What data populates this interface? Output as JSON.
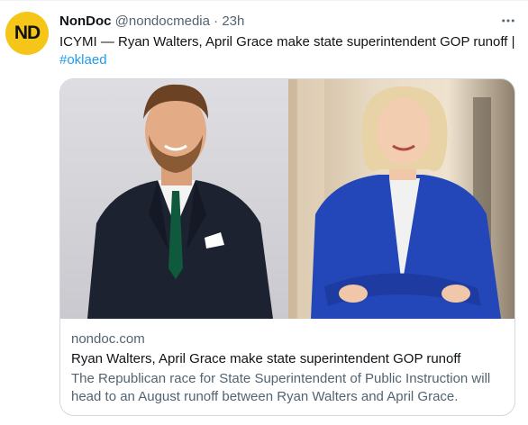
{
  "tweet": {
    "avatar_text": "ND",
    "display_name": "NonDoc",
    "handle": "@nondocmedia",
    "separator": "·",
    "time": "23h",
    "more_icon": "more-horizontal-icon",
    "text": "ICYMI — Ryan Walters, April Grace make state superintendent GOP runoff |",
    "hashtag": "#oklaed"
  },
  "card": {
    "domain": "nondoc.com",
    "title": "Ryan Walters, April Grace make state superintendent GOP runoff",
    "description": "The Republican race for State Superintendent of Public Instruction will head to an August runoff between Ryan Walters and April Grace."
  },
  "colors": {
    "link": "#1d9bf0",
    "muted": "#536471",
    "avatar_bg": "#f5c518"
  }
}
